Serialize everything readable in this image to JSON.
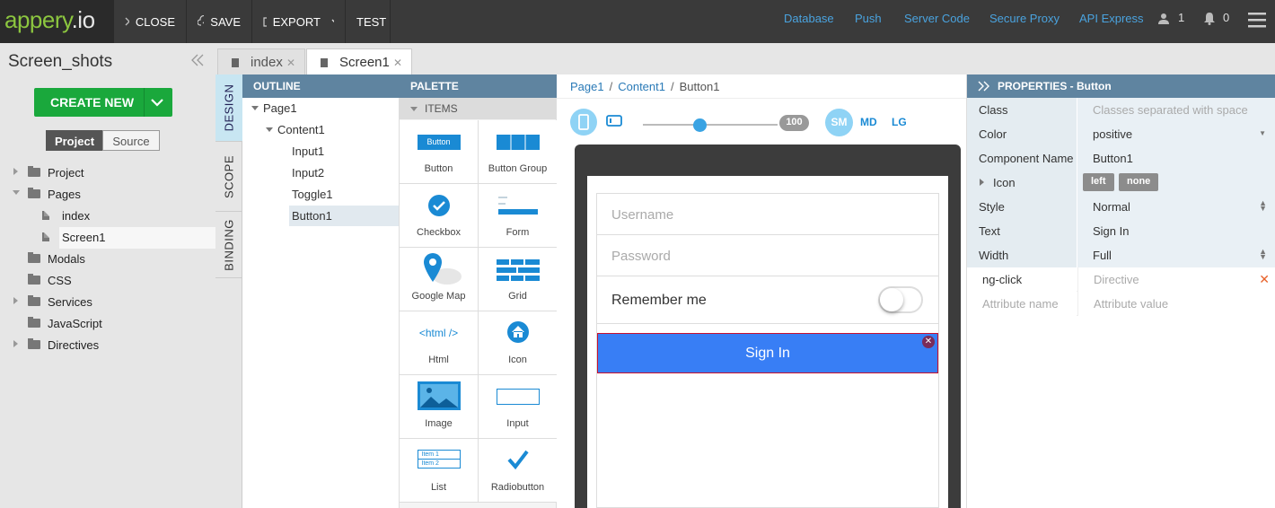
{
  "topbar": {
    "logo_main": "appery",
    "logo_suffix": ".io",
    "close_label": "CLOSE",
    "save_label": "SAVE",
    "export_label": "EXPORT",
    "test_label": "TEST",
    "links": [
      "Database",
      "Push",
      "Server Code",
      "Secure Proxy",
      "API Express"
    ],
    "user_count": "1",
    "notification_count": "0"
  },
  "left": {
    "project_title": "Screen_shots",
    "create_new_label": "CREATE NEW",
    "tab_project": "Project",
    "tab_source": "Source",
    "tree": {
      "project": "Project",
      "pages": "Pages",
      "page_index": "index",
      "page_screen1": "Screen1",
      "modals": "Modals",
      "css": "CSS",
      "services": "Services",
      "javascript": "JavaScript",
      "directives": "Directives"
    }
  },
  "file_tabs": [
    "index",
    "Screen1"
  ],
  "vertical_tabs": [
    "DESIGN",
    "SCOPE",
    "BINDING"
  ],
  "outline": {
    "header": "OUTLINE",
    "nodes": [
      "Page1",
      "Content1",
      "Input1",
      "Input2",
      "Toggle1",
      "Button1"
    ]
  },
  "palette": {
    "header": "PALETTE",
    "section": "ITEMS",
    "button_icon_text": "Button",
    "html_icon_text": "<html />",
    "list_icon_items": [
      "Item 1",
      "Item 2"
    ],
    "items": [
      "Button",
      "Button Group",
      "Checkbox",
      "Form",
      "Google Map",
      "Grid",
      "Html",
      "Icon",
      "Image",
      "Input",
      "List",
      "Radiobutton"
    ]
  },
  "canvas": {
    "breadcrumb": [
      "Page1",
      "Content1",
      "Button1"
    ],
    "zoom_value": "100",
    "zoom_level": 0.42,
    "size_sm": "SM",
    "size_md": "MD",
    "size_lg": "LG",
    "username_placeholder": "Username",
    "password_placeholder": "Password",
    "remember_label": "Remember me",
    "signin_label": "Sign In",
    "accent": "#387ef5"
  },
  "properties": {
    "header": "PROPERTIES - Button",
    "class_label": "Class",
    "class_placeholder": "Classes separated with space",
    "color_label": "Color",
    "color_value": "positive",
    "component_name_label": "Component Name",
    "component_name_value": "Button1",
    "icon_label": "Icon",
    "icon_left": "left",
    "icon_none": "none",
    "style_label": "Style",
    "style_value": "Normal",
    "text_label": "Text",
    "text_value": "Sign In",
    "width_label": "Width",
    "width_value": "Full",
    "ngclick_label": "ng-click",
    "ngclick_value": "Directive",
    "attr_name_placeholder": "Attribute name",
    "attr_value_placeholder": "Attribute value"
  }
}
